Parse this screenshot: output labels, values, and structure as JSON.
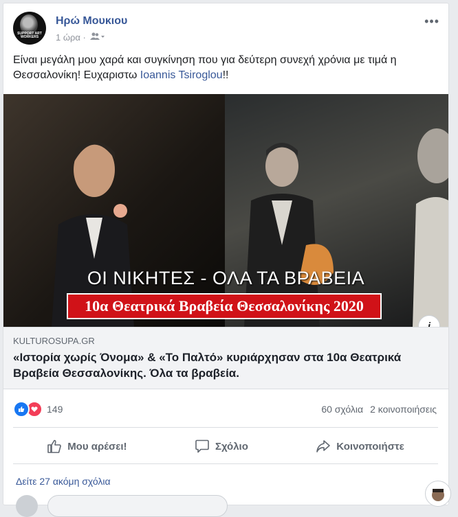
{
  "post": {
    "author": "Ηρώ Μουκιου",
    "time": "1 ώρα ·",
    "text_before": "Είναι μεγάλη μου χαρά και συγκίνηση που για δεύτερη συνεχή χρόνια με τιμά η Θεσσαλονίκη! Ευχαριστω ",
    "mention": "Ioannis Tsiroglou",
    "text_after": "!!"
  },
  "avatar_badge": "SUPPORT ART WORKERS",
  "image": {
    "headline": "ΟΙ ΝΙΚΗΤΕΣ - ΟΛΑ ΤΑ ΒΡΑΒΕΙΑ",
    "banner": "10α Θεατρικά Βραβεία Θεσσαλονίκης 2020",
    "info": "i"
  },
  "link": {
    "domain": "KULTUROSUPA.GR",
    "title": "«Ιστορία χωρίς Όνομα» & «Το Παλτό» κυριάρχησαν στα 10α Θεατρικά Βραβεία Θεσσαλονίκης. Όλα τα βραβεία."
  },
  "stats": {
    "reactions": "149",
    "comments": "60 σχόλια",
    "shares": "2 κοινοποιήσεις"
  },
  "actions": {
    "like": "Μου αρέσει!",
    "comment": "Σχόλιο",
    "share": "Κοινοποιήστε"
  },
  "view_more": "Δείτε 27 ακόμη σχόλια",
  "colors": {
    "link_blue": "#385898",
    "like_blue": "#1877f2",
    "love_red": "#f33e58",
    "banner_red": "#d01218"
  }
}
